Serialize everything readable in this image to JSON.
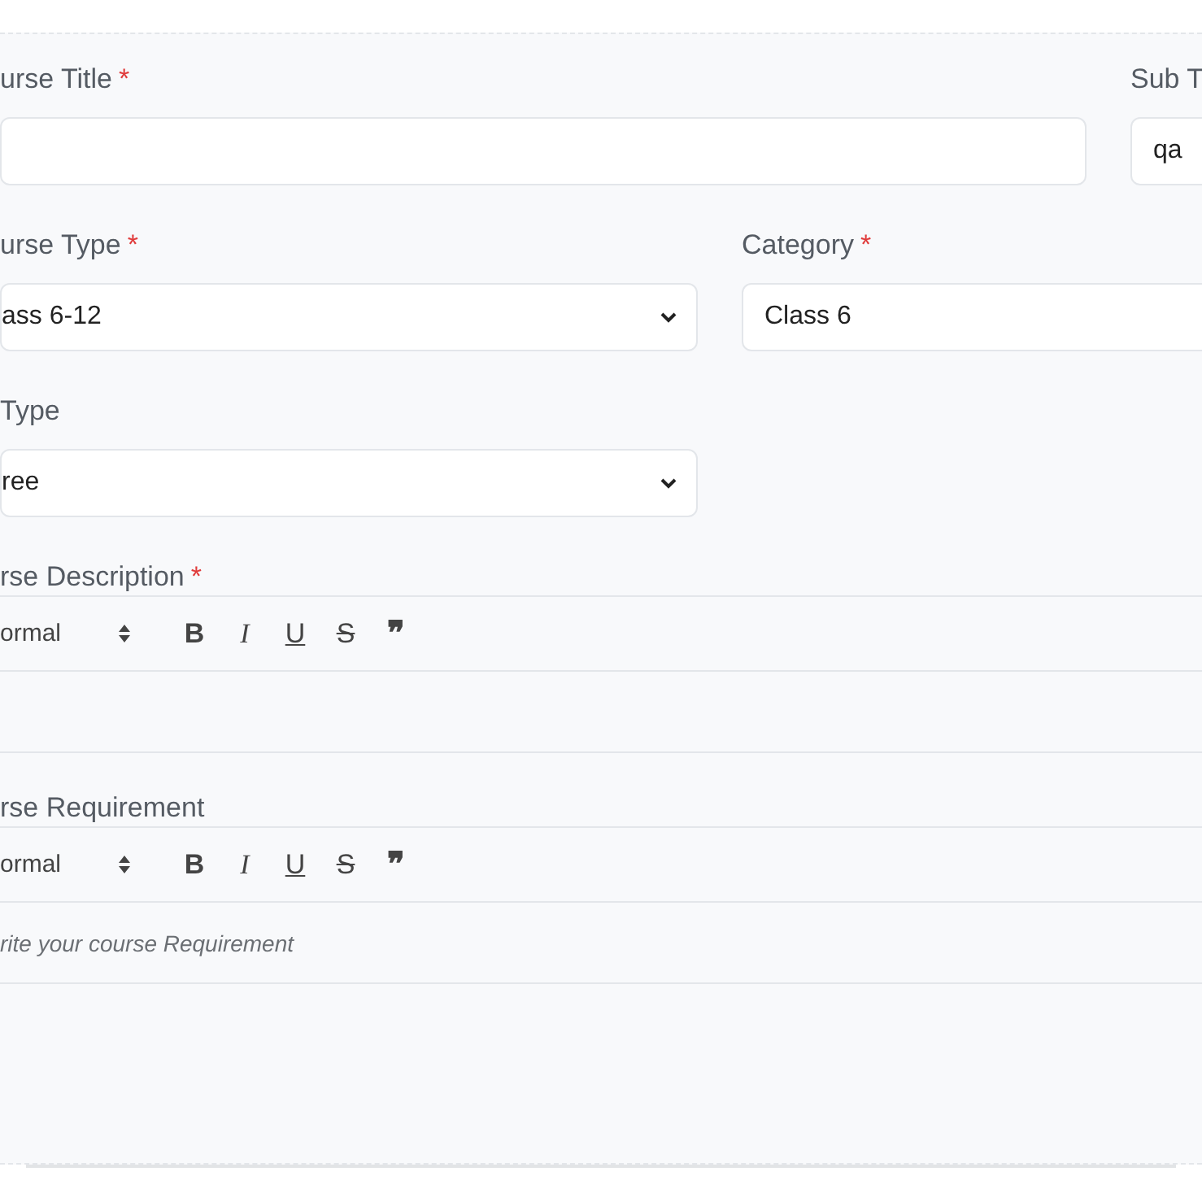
{
  "rows": [
    {
      "kind": "wide",
      "fields": [
        {
          "label": "urse Title",
          "required_mark": "*",
          "kind": "input"
        },
        {
          "label": "Sub T",
          "kind": "input",
          "value": "qa"
        }
      ]
    },
    {
      "kind": "half",
      "fields": [
        {
          "label": "urse Type",
          "required_mark": "*",
          "kind": "select",
          "value": "ass 6-12"
        },
        {
          "label": "Category",
          "required_mark": "*",
          "kind": "input",
          "value": "Class 6"
        }
      ]
    },
    {
      "kind": "half",
      "fields": [
        {
          "label": "Type",
          "kind": "select",
          "value": "ree"
        }
      ]
    }
  ],
  "editors": [
    {
      "label": "rse Description",
      "required_mark": "*",
      "format": "ormal",
      "buttons": [
        {
          "kind": "bold",
          "label": "B"
        },
        {
          "kind": "italic",
          "label": "I"
        },
        {
          "kind": "underline",
          "label": "U"
        },
        {
          "kind": "strike",
          "label": "S"
        },
        {
          "kind": "quote",
          "label": "❞"
        }
      ]
    },
    {
      "label": "rse Requirement",
      "format": "ormal",
      "buttons": [
        {
          "kind": "bold",
          "label": "B"
        },
        {
          "kind": "italic",
          "label": "I"
        },
        {
          "kind": "underline",
          "label": "U"
        },
        {
          "kind": "strike",
          "label": "S"
        },
        {
          "kind": "quote",
          "label": "❞"
        }
      ],
      "placeholder": "rite your course Requirement"
    }
  ]
}
